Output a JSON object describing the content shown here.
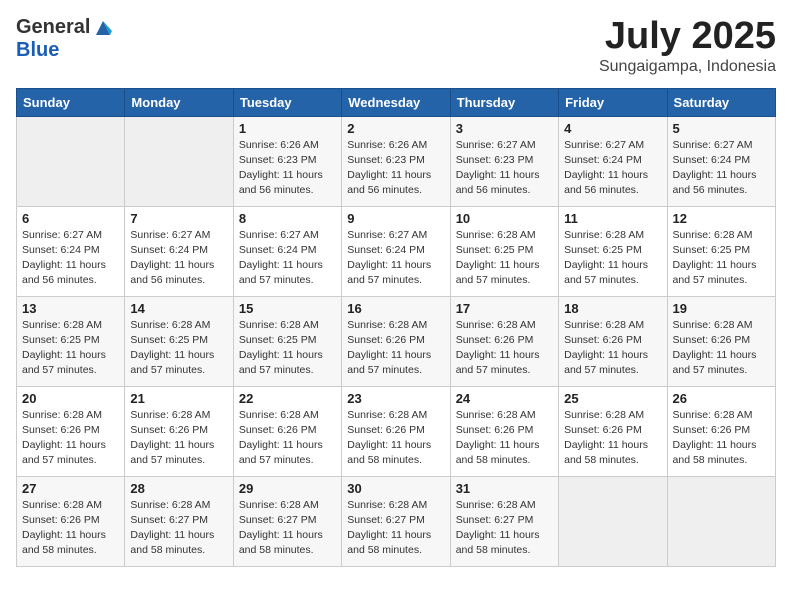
{
  "logo": {
    "general": "General",
    "blue": "Blue"
  },
  "title": "July 2025",
  "location": "Sungaigampa, Indonesia",
  "days_of_week": [
    "Sunday",
    "Monday",
    "Tuesday",
    "Wednesday",
    "Thursday",
    "Friday",
    "Saturday"
  ],
  "weeks": [
    [
      {
        "day": "",
        "info": ""
      },
      {
        "day": "",
        "info": ""
      },
      {
        "day": "1",
        "info": "Sunrise: 6:26 AM\nSunset: 6:23 PM\nDaylight: 11 hours and 56 minutes."
      },
      {
        "day": "2",
        "info": "Sunrise: 6:26 AM\nSunset: 6:23 PM\nDaylight: 11 hours and 56 minutes."
      },
      {
        "day": "3",
        "info": "Sunrise: 6:27 AM\nSunset: 6:23 PM\nDaylight: 11 hours and 56 minutes."
      },
      {
        "day": "4",
        "info": "Sunrise: 6:27 AM\nSunset: 6:24 PM\nDaylight: 11 hours and 56 minutes."
      },
      {
        "day": "5",
        "info": "Sunrise: 6:27 AM\nSunset: 6:24 PM\nDaylight: 11 hours and 56 minutes."
      }
    ],
    [
      {
        "day": "6",
        "info": "Sunrise: 6:27 AM\nSunset: 6:24 PM\nDaylight: 11 hours and 56 minutes."
      },
      {
        "day": "7",
        "info": "Sunrise: 6:27 AM\nSunset: 6:24 PM\nDaylight: 11 hours and 56 minutes."
      },
      {
        "day": "8",
        "info": "Sunrise: 6:27 AM\nSunset: 6:24 PM\nDaylight: 11 hours and 57 minutes."
      },
      {
        "day": "9",
        "info": "Sunrise: 6:27 AM\nSunset: 6:24 PM\nDaylight: 11 hours and 57 minutes."
      },
      {
        "day": "10",
        "info": "Sunrise: 6:28 AM\nSunset: 6:25 PM\nDaylight: 11 hours and 57 minutes."
      },
      {
        "day": "11",
        "info": "Sunrise: 6:28 AM\nSunset: 6:25 PM\nDaylight: 11 hours and 57 minutes."
      },
      {
        "day": "12",
        "info": "Sunrise: 6:28 AM\nSunset: 6:25 PM\nDaylight: 11 hours and 57 minutes."
      }
    ],
    [
      {
        "day": "13",
        "info": "Sunrise: 6:28 AM\nSunset: 6:25 PM\nDaylight: 11 hours and 57 minutes."
      },
      {
        "day": "14",
        "info": "Sunrise: 6:28 AM\nSunset: 6:25 PM\nDaylight: 11 hours and 57 minutes."
      },
      {
        "day": "15",
        "info": "Sunrise: 6:28 AM\nSunset: 6:25 PM\nDaylight: 11 hours and 57 minutes."
      },
      {
        "day": "16",
        "info": "Sunrise: 6:28 AM\nSunset: 6:26 PM\nDaylight: 11 hours and 57 minutes."
      },
      {
        "day": "17",
        "info": "Sunrise: 6:28 AM\nSunset: 6:26 PM\nDaylight: 11 hours and 57 minutes."
      },
      {
        "day": "18",
        "info": "Sunrise: 6:28 AM\nSunset: 6:26 PM\nDaylight: 11 hours and 57 minutes."
      },
      {
        "day": "19",
        "info": "Sunrise: 6:28 AM\nSunset: 6:26 PM\nDaylight: 11 hours and 57 minutes."
      }
    ],
    [
      {
        "day": "20",
        "info": "Sunrise: 6:28 AM\nSunset: 6:26 PM\nDaylight: 11 hours and 57 minutes."
      },
      {
        "day": "21",
        "info": "Sunrise: 6:28 AM\nSunset: 6:26 PM\nDaylight: 11 hours and 57 minutes."
      },
      {
        "day": "22",
        "info": "Sunrise: 6:28 AM\nSunset: 6:26 PM\nDaylight: 11 hours and 57 minutes."
      },
      {
        "day": "23",
        "info": "Sunrise: 6:28 AM\nSunset: 6:26 PM\nDaylight: 11 hours and 58 minutes."
      },
      {
        "day": "24",
        "info": "Sunrise: 6:28 AM\nSunset: 6:26 PM\nDaylight: 11 hours and 58 minutes."
      },
      {
        "day": "25",
        "info": "Sunrise: 6:28 AM\nSunset: 6:26 PM\nDaylight: 11 hours and 58 minutes."
      },
      {
        "day": "26",
        "info": "Sunrise: 6:28 AM\nSunset: 6:26 PM\nDaylight: 11 hours and 58 minutes."
      }
    ],
    [
      {
        "day": "27",
        "info": "Sunrise: 6:28 AM\nSunset: 6:26 PM\nDaylight: 11 hours and 58 minutes."
      },
      {
        "day": "28",
        "info": "Sunrise: 6:28 AM\nSunset: 6:27 PM\nDaylight: 11 hours and 58 minutes."
      },
      {
        "day": "29",
        "info": "Sunrise: 6:28 AM\nSunset: 6:27 PM\nDaylight: 11 hours and 58 minutes."
      },
      {
        "day": "30",
        "info": "Sunrise: 6:28 AM\nSunset: 6:27 PM\nDaylight: 11 hours and 58 minutes."
      },
      {
        "day": "31",
        "info": "Sunrise: 6:28 AM\nSunset: 6:27 PM\nDaylight: 11 hours and 58 minutes."
      },
      {
        "day": "",
        "info": ""
      },
      {
        "day": "",
        "info": ""
      }
    ]
  ]
}
